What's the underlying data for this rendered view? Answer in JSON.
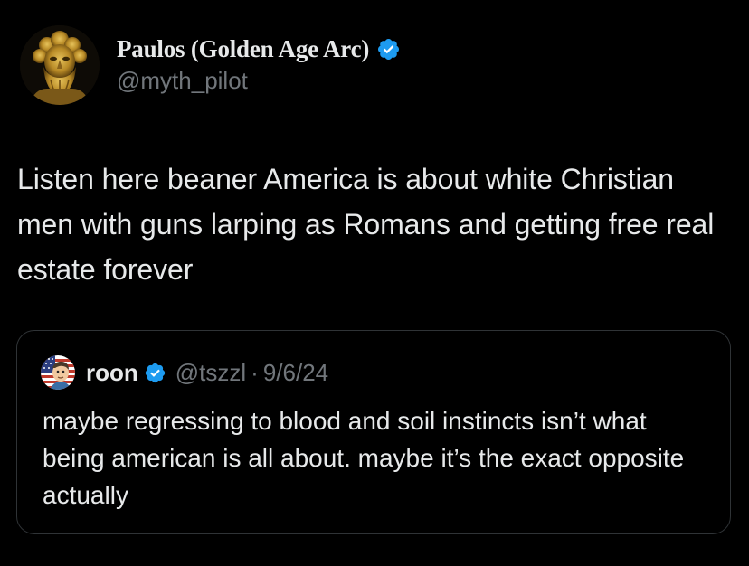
{
  "post": {
    "author": {
      "display_name": "Paulos (Golden Age Arc)",
      "handle": "@myth_pilot",
      "avatar_icon": "golden-statue-avatar",
      "verified_icon": "verified-badge-icon"
    },
    "text": "Listen here beaner America is about white Christian men with guns larping as Romans and getting free real estate forever"
  },
  "quote": {
    "author": {
      "display_name": "roon",
      "handle": "@tszzl",
      "avatar_icon": "flag-cartoon-avatar",
      "verified_icon": "verified-badge-icon"
    },
    "separator": "·",
    "date": "9/6/24",
    "text": "maybe regressing to blood and soil instincts isn’t what being american is all about. maybe it’s the exact opposite actually"
  },
  "colors": {
    "background": "#000000",
    "text_primary": "#e7e9ea",
    "text_secondary": "#71767b",
    "border": "#2f3336",
    "verified_blue": "#1d9bf0",
    "avatar_gold": "#c9a23a"
  }
}
